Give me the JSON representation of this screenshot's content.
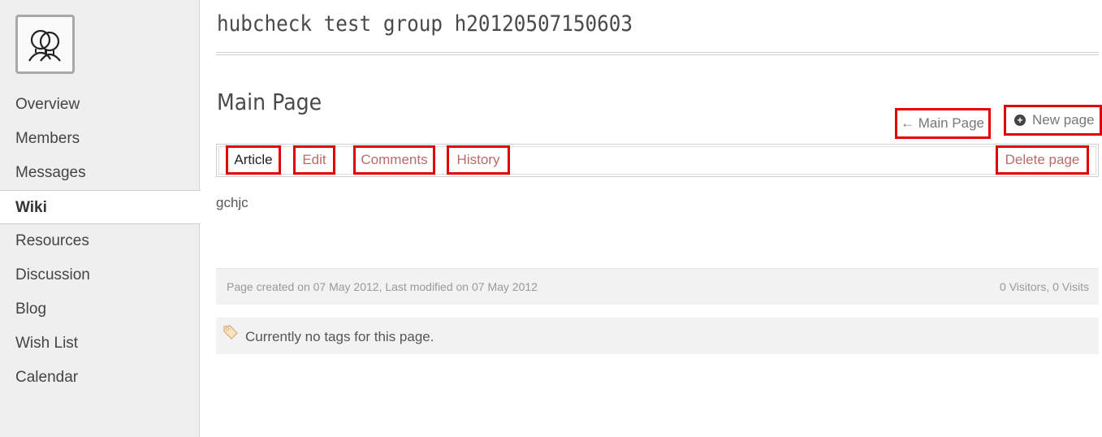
{
  "group": {
    "title": "hubcheck test group h20120507150603",
    "logo_icon": "group-people-icon"
  },
  "sidebar": {
    "items": [
      {
        "label": "Overview",
        "active": false
      },
      {
        "label": "Members",
        "active": false
      },
      {
        "label": "Messages",
        "active": false
      },
      {
        "label": "Wiki",
        "active": true
      },
      {
        "label": "Resources",
        "active": false
      },
      {
        "label": "Discussion",
        "active": false
      },
      {
        "label": "Blog",
        "active": false
      },
      {
        "label": "Wish List",
        "active": false
      },
      {
        "label": "Calendar",
        "active": false
      }
    ]
  },
  "page": {
    "title": "Main Page",
    "main_page_link": "← Main Page",
    "new_page_link": "New page",
    "new_page_icon": "plus-circle-icon"
  },
  "tabs": {
    "article": "Article",
    "edit": "Edit",
    "comments": "Comments",
    "history": "History",
    "delete": "Delete page"
  },
  "content": {
    "text": "gchjc"
  },
  "meta": {
    "created": "Page created on 07 May 2012, Last modified on 07 May 2012",
    "stats": "0 Visitors, 0 Visits"
  },
  "tags": {
    "icon": "tag-icon",
    "text": "Currently no tags for this page."
  },
  "colors": {
    "highlight": "#e00000",
    "link": "#b96b6b",
    "sidebar_bg": "#efefef"
  }
}
